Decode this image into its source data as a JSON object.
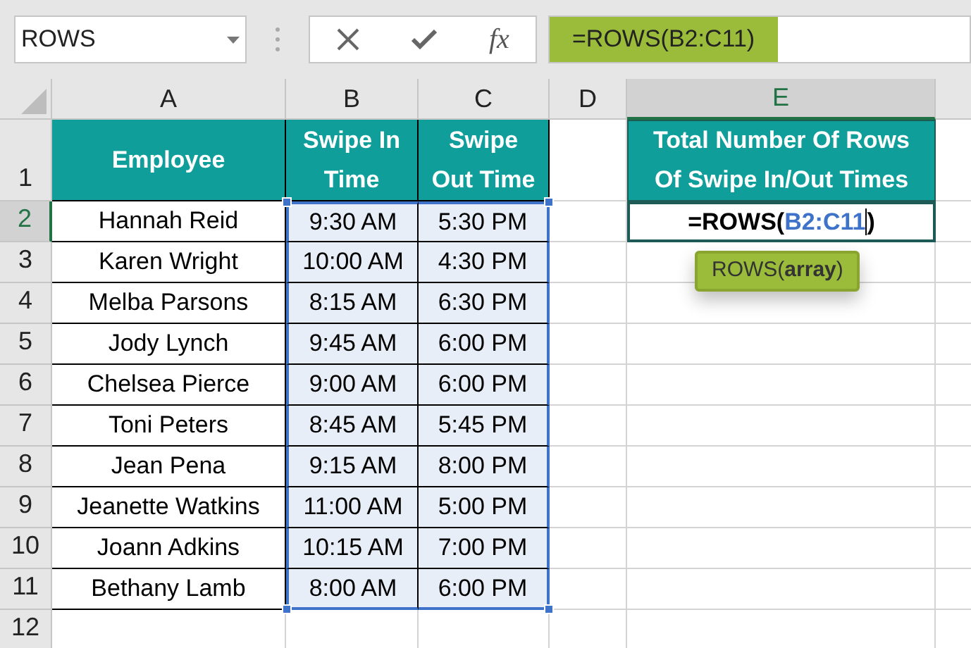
{
  "name_box": {
    "value": "ROWS"
  },
  "formula_bar": {
    "fx_label": "fx",
    "value": "=ROWS(B2:C11)",
    "editing": true
  },
  "column_headers": [
    {
      "label": "A",
      "selected": false
    },
    {
      "label": "B",
      "selected": false
    },
    {
      "label": "C",
      "selected": false
    },
    {
      "label": "D",
      "selected": false
    },
    {
      "label": "E",
      "selected": true
    }
  ],
  "row_headers": [
    {
      "label": "1",
      "selected": false
    },
    {
      "label": "2",
      "selected": true
    },
    {
      "label": "3",
      "selected": false
    },
    {
      "label": "4",
      "selected": false
    },
    {
      "label": "5",
      "selected": false
    },
    {
      "label": "6",
      "selected": false
    },
    {
      "label": "7",
      "selected": false
    },
    {
      "label": "8",
      "selected": false
    },
    {
      "label": "9",
      "selected": false
    },
    {
      "label": "10",
      "selected": false
    },
    {
      "label": "11",
      "selected": false
    },
    {
      "label": "12",
      "selected": false
    }
  ],
  "table": {
    "columns": [
      "Employee",
      "Swipe In Time",
      "Swipe Out Time"
    ],
    "rows": [
      {
        "cells": [
          "Hannah Reid",
          "9:30 AM",
          "5:30 PM"
        ],
        "in_range": true
      },
      {
        "cells": [
          "Karen Wright",
          "10:00 AM",
          "4:30 PM"
        ],
        "in_range": true
      },
      {
        "cells": [
          "Melba Parsons",
          "8:15 AM",
          "6:30 PM"
        ],
        "in_range": true
      },
      {
        "cells": [
          "Jody Lynch",
          "9:45 AM",
          "6:00 PM"
        ],
        "in_range": true
      },
      {
        "cells": [
          "Chelsea Pierce",
          "9:00 AM",
          "6:00 PM"
        ],
        "in_range": true
      },
      {
        "cells": [
          "Toni Peters",
          "8:45 AM",
          "5:45 PM"
        ],
        "in_range": true
      },
      {
        "cells": [
          "Jean Pena",
          "9:15 AM",
          "8:00 PM"
        ],
        "in_range": true
      },
      {
        "cells": [
          "Jeanette Watkins",
          "11:00 AM",
          "5:00 PM"
        ],
        "in_range": true
      },
      {
        "cells": [
          "Joann Adkins",
          "10:15 AM",
          "7:00 PM"
        ],
        "in_range": true
      },
      {
        "cells": [
          "Bethany Lamb",
          "8:00 AM",
          "6:00 PM"
        ],
        "in_range": true
      }
    ]
  },
  "result": {
    "header": "Total Number Of Rows Of Swipe In/Out Times",
    "formula_parts": [
      {
        "kind": "text",
        "text": "=ROWS("
      },
      {
        "kind": "ref",
        "text": "B2:C11"
      },
      {
        "kind": "text",
        "text": ")"
      }
    ],
    "tooltip": "ROWS(**array**)"
  }
}
